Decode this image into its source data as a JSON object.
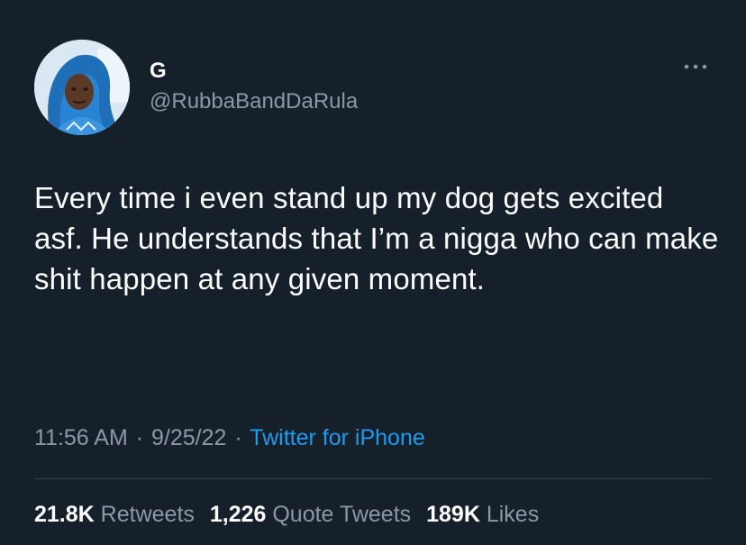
{
  "author": {
    "display_name": "G",
    "handle": "@RubbaBandDaRula"
  },
  "tweet": {
    "text": "Every time i even stand up my dog gets excited asf. He understands that I’m a nigga who can make shit happen at any given moment."
  },
  "meta": {
    "time": "11:56 AM",
    "separator": "·",
    "date": "9/25/22",
    "source": "Twitter for iPhone"
  },
  "stats": {
    "retweets_count": "21.8K",
    "retweets_label": "Retweets",
    "quotes_count": "1,226",
    "quotes_label": "Quote Tweets",
    "likes_count": "189K",
    "likes_label": "Likes"
  },
  "icons": {
    "more": "more-horizontal-icon"
  },
  "colors": {
    "background": "#15202b",
    "text_primary": "#ffffff",
    "text_secondary": "#8b98a5",
    "link": "#1d9bf0",
    "divider": "#2f3b47"
  }
}
